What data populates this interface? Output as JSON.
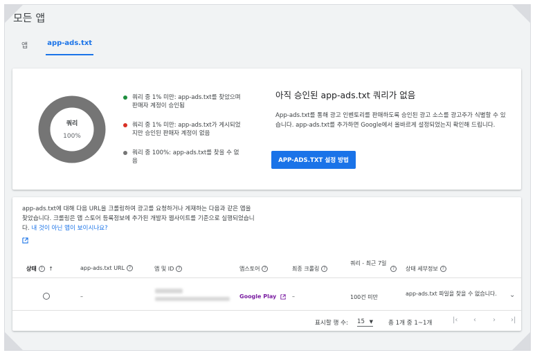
{
  "page": {
    "title": "모든 앱"
  },
  "tabs": [
    {
      "label": "앱"
    },
    {
      "label": "app-ads.txt"
    }
  ],
  "summary": {
    "donut_label": "쿼리",
    "donut_percent": "100%",
    "legend": [
      {
        "text": "쿼리 중 1% 미만: app-ads.txt를 찾았으며 판매자 계정이 승인됨",
        "color": "#1e8e3e",
        "share": 0
      },
      {
        "text": "쿼리 중 1% 미만: app-ads.txt가 게시되었지만 승인된 판매자 계정이 없음",
        "color": "#d93025",
        "share": 0
      },
      {
        "text": "쿼리 중 100%: app-ads.txt를 찾을 수 없음",
        "color": "#757575",
        "share": 100
      }
    ],
    "info_title": "아직 승인된 app-ads.txt 쿼리가 없음",
    "info_desc": "App-ads.txt를 통해 광고 인벤토리를 판매하도록 승인된 광고 소스를 광고주가 식별할 수 있습니다. app-ads.txt를 추가하면 Google에서 올바르게 설정되었는지 확인해 드립니다.",
    "button_label": "APP-ADS.TXT 설정 방법"
  },
  "crawl": {
    "description": "app-ads.txt에 대해 다음 URL을 크롤링하여 광고를 요청하거나 게재하는 다음과 같은 앱을 찾았습니다. 크롤링은 앱 스토어 등록정보에 추가된 개발자 웹사이트를 기준으로 실행되었습니다.",
    "link_text": "내 것이 아닌 앱이 보이시나요?",
    "columns": {
      "status": "상태",
      "url": "app-ads.txt URL",
      "app": "앱 및 ID",
      "store": "앱스토어",
      "last_crawl": "최종 크롤링",
      "queries": "쿼리 - 최근 7일",
      "details": "상태 세부정보"
    },
    "rows": [
      {
        "url": "–",
        "store": "Google Play",
        "last_crawl": "–",
        "queries": "100건 미만",
        "details": "app-ads.txt 파일을 찾을 수 없습니다."
      }
    ],
    "pagination": {
      "rows_label": "표시할 행 수:",
      "rows_value": "15",
      "range": "총 1개 중 1~1개"
    }
  },
  "colors": {
    "accent": "#1a73e8",
    "donut": "#757575"
  }
}
